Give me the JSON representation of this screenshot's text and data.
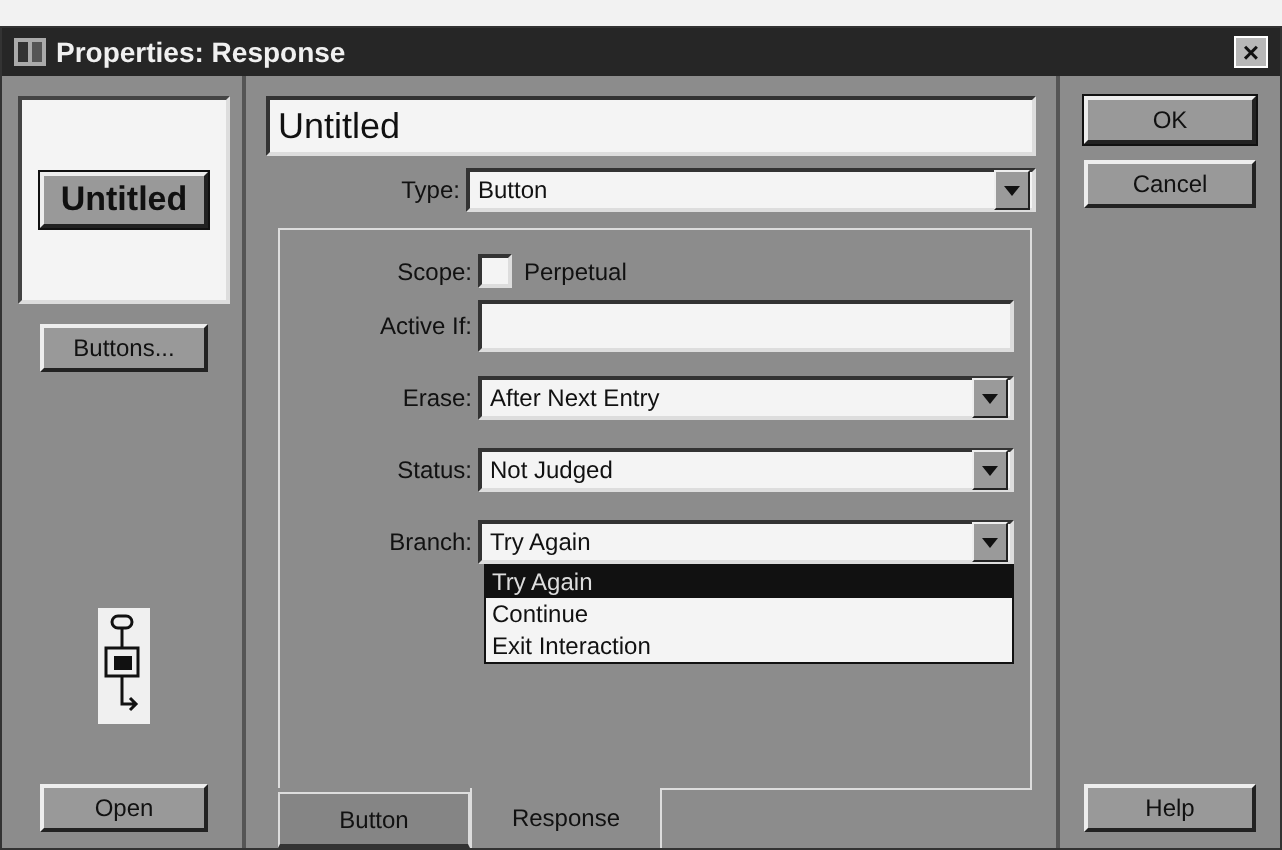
{
  "window": {
    "title": "Properties: Response",
    "close": "×"
  },
  "preview": {
    "button_label": "Untitled"
  },
  "left_buttons": [
    {
      "label": "Buttons..."
    },
    {
      "label": "Open"
    }
  ],
  "title_field": {
    "value": "Untitled"
  },
  "type": {
    "label": "Type:",
    "value": "Button"
  },
  "scope": {
    "label": "Scope:",
    "option": "Perpetual",
    "checked": false
  },
  "active_if": {
    "label": "Active If:"
  },
  "dropdowns": [
    {
      "label": "Erase:",
      "value": "After Next Entry",
      "expanded": false
    },
    {
      "label": "Status:",
      "value": "Not Judged",
      "expanded": false
    },
    {
      "label": "Branch:",
      "value": "Try Again",
      "expanded": true,
      "options": [
        {
          "label": "Try Again",
          "selected": true
        },
        {
          "label": "Continue",
          "selected": false
        },
        {
          "label": "Exit Interaction",
          "selected": false
        }
      ]
    }
  ],
  "tabs": [
    {
      "label": "Button",
      "selected": false
    },
    {
      "label": "Response",
      "selected": true
    }
  ],
  "right_buttons": [
    {
      "label": "OK",
      "default": true
    },
    {
      "label": "Cancel",
      "default": false
    }
  ],
  "help_button": {
    "label": "Help"
  }
}
